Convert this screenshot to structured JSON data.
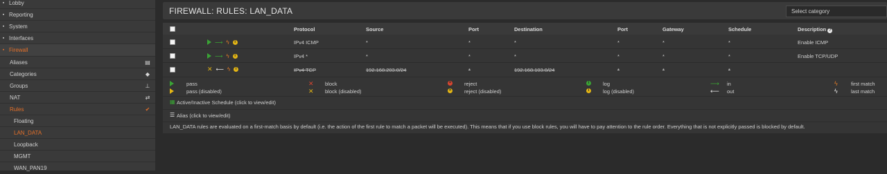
{
  "sidebar": {
    "items": [
      {
        "label": "Lobby",
        "icon": "lobby-icon"
      },
      {
        "label": "Reporting",
        "icon": "reporting-icon"
      },
      {
        "label": "System",
        "icon": "system-icon"
      },
      {
        "label": "Interfaces",
        "icon": "interfaces-icon"
      },
      {
        "label": "Firewall",
        "icon": "firewall-icon"
      },
      {
        "label": "Aliases",
        "icon": "list-icon"
      },
      {
        "label": "Categories",
        "icon": "tag-icon"
      },
      {
        "label": "Groups",
        "icon": "sitemap-icon"
      },
      {
        "label": "NAT",
        "icon": "exchange-icon"
      },
      {
        "label": "Rules",
        "icon": "check-icon"
      },
      {
        "label": "Floating"
      },
      {
        "label": "LAN_DATA"
      },
      {
        "label": "Loopback"
      },
      {
        "label": "MGMT"
      },
      {
        "label": "WAN_PAN19"
      }
    ]
  },
  "header": {
    "title": "FIREWALL: RULES: LAN_DATA",
    "category_select": "Select category"
  },
  "table": {
    "columns": [
      "Protocol",
      "Source",
      "Port",
      "Destination",
      "Port",
      "Gateway",
      "Schedule",
      "Description"
    ],
    "rows": [
      {
        "protocol": "IPv4 ICMP",
        "source": "*",
        "sport": "*",
        "destination": "*",
        "dport": "*",
        "gateway": "*",
        "schedule": "*",
        "description": "Enable ICMP"
      },
      {
        "protocol": "IPv4 *",
        "source": "*",
        "sport": "*",
        "destination": "*",
        "dport": "*",
        "gateway": "*",
        "schedule": "*",
        "description": "Enable TCP/UDP"
      },
      {
        "protocol": "IPv4 TCP",
        "source": "192.168.203.0/24",
        "sport": "*",
        "destination": "192.168.103.0/24",
        "dport": "*",
        "gateway": "*",
        "schedule": "*",
        "description": ""
      }
    ]
  },
  "legend": {
    "pass": "pass",
    "pass_disabled": "pass (disabled)",
    "block": "block",
    "block_disabled": "block (disabled)",
    "reject": "reject",
    "reject_disabled": "reject (disabled)",
    "log": "log",
    "log_disabled": "log (disabled)",
    "in": "in",
    "out": "out",
    "first_match": "first match",
    "last_match": "last match"
  },
  "info": {
    "schedule": "Active/Inactive Schedule (click to view/edit)",
    "alias": "Alias (click to view/edit)",
    "note": "LAN_DATA rules are evaluated on a first-match basis by default (i.e. the action of the first rule to match a packet will be executed). This means that if you use block rules, you will have to pay attention to the rule order. Everything that is not explicitly passed is blocked by default."
  },
  "colors": {
    "accent": "#e3702a",
    "pass": "#3aa335",
    "disabled": "#e3b515",
    "block": "#d84630"
  }
}
